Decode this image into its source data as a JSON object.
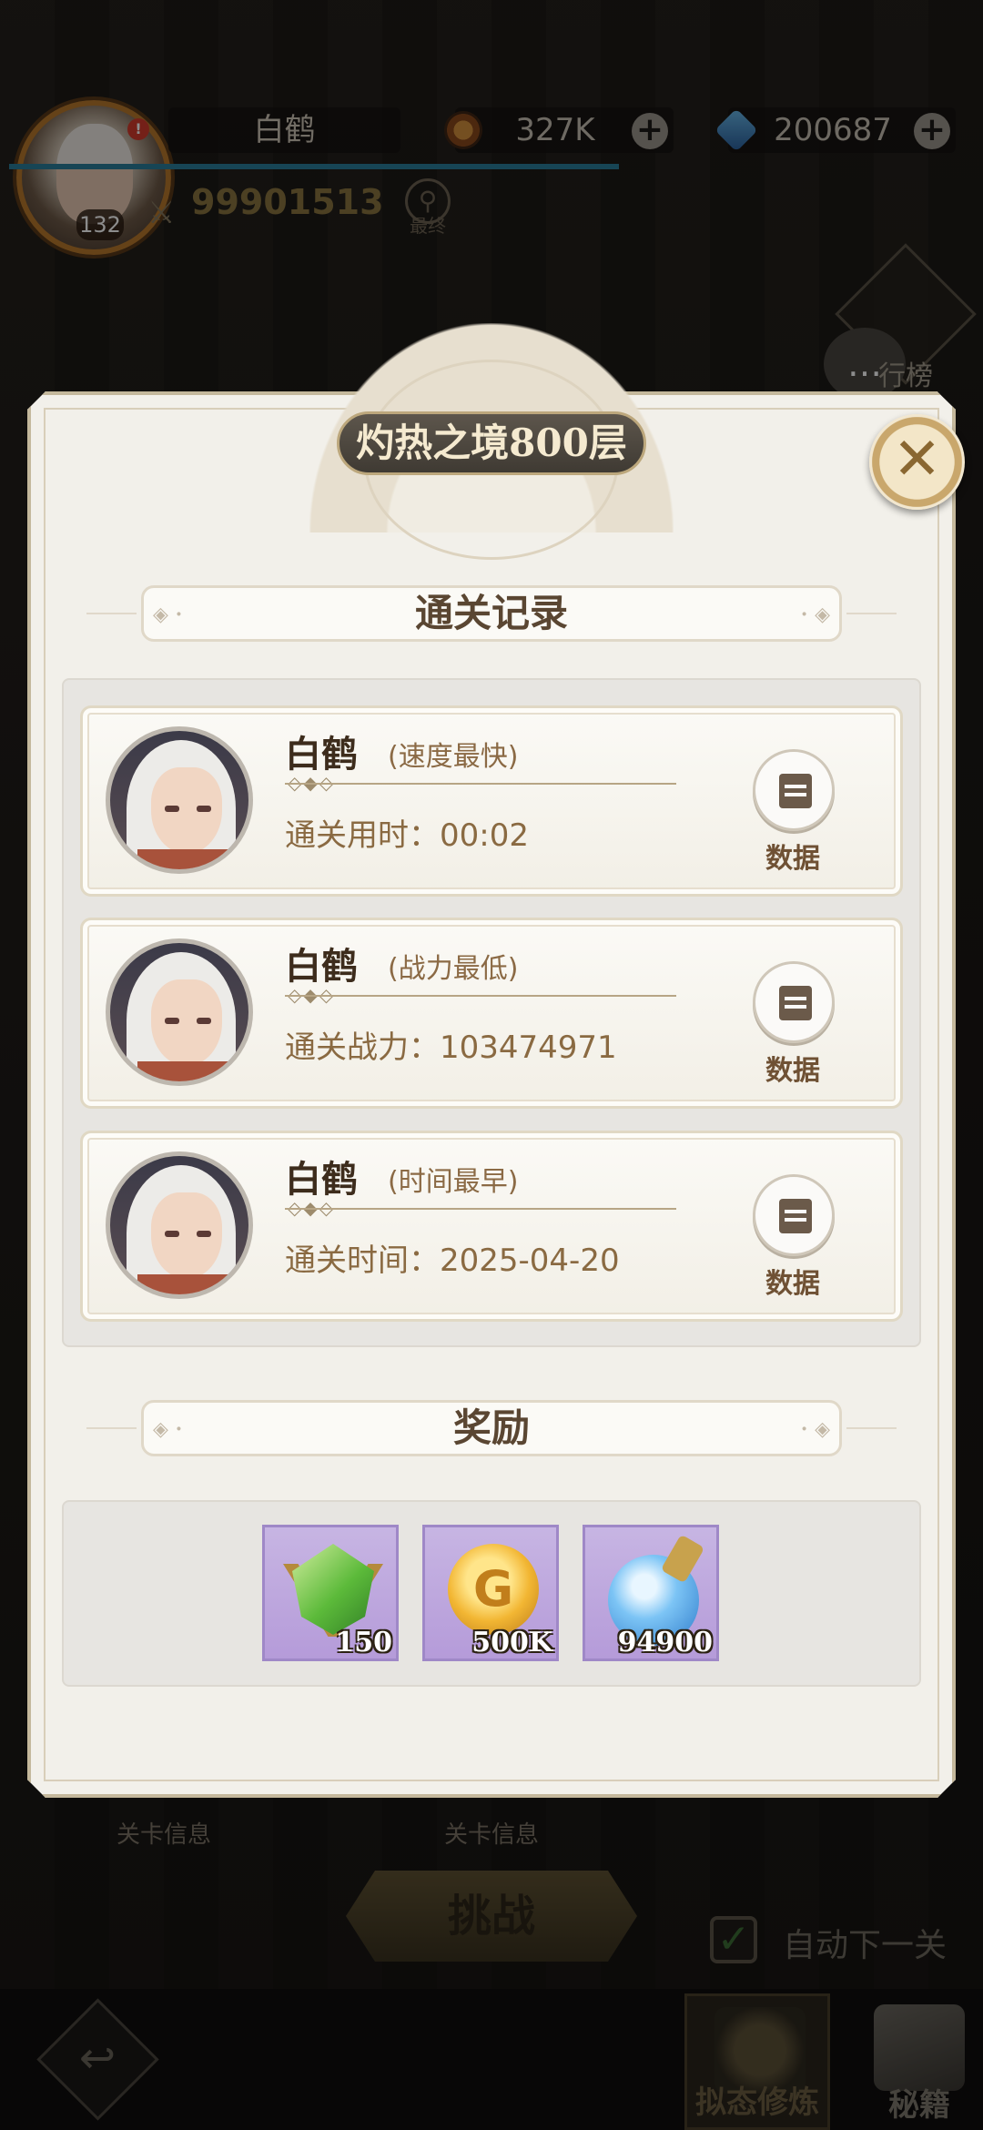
{
  "player": {
    "name": "白鹤",
    "level": "132",
    "power": "99901513",
    "final_label": "最终"
  },
  "resources": {
    "gold": "327K",
    "gems": "200687"
  },
  "side": {
    "leaderboard_label": "行榜"
  },
  "modal": {
    "title": "灼热之境800层",
    "records_header": "通关记录",
    "rewards_header": "奖励",
    "records": [
      {
        "name": "白鹤",
        "tag": "(速度最快)",
        "stat": "通关用时：00:02",
        "data_label": "数据"
      },
      {
        "name": "白鹤",
        "tag": "(战力最低)",
        "stat": "通关战力：103474971",
        "data_label": "数据"
      },
      {
        "name": "白鹤",
        "tag": "(时间最早)",
        "stat": "通关时间：2025-04-20",
        "data_label": "数据"
      }
    ],
    "rewards": [
      {
        "icon": "green-gem-icon",
        "quantity": "150"
      },
      {
        "icon": "gold-coin-icon",
        "quantity": "500K"
      },
      {
        "icon": "potion-icon",
        "quantity": "94900"
      }
    ]
  },
  "behind": {
    "stage_info_1": "关卡信息",
    "stage_info_2": "关卡信息",
    "challenge": "挑战",
    "auto_next": "自动下一关"
  },
  "bottom_nav": {
    "tab_active": "拟态修炼",
    "tab_secret": "秘籍"
  }
}
